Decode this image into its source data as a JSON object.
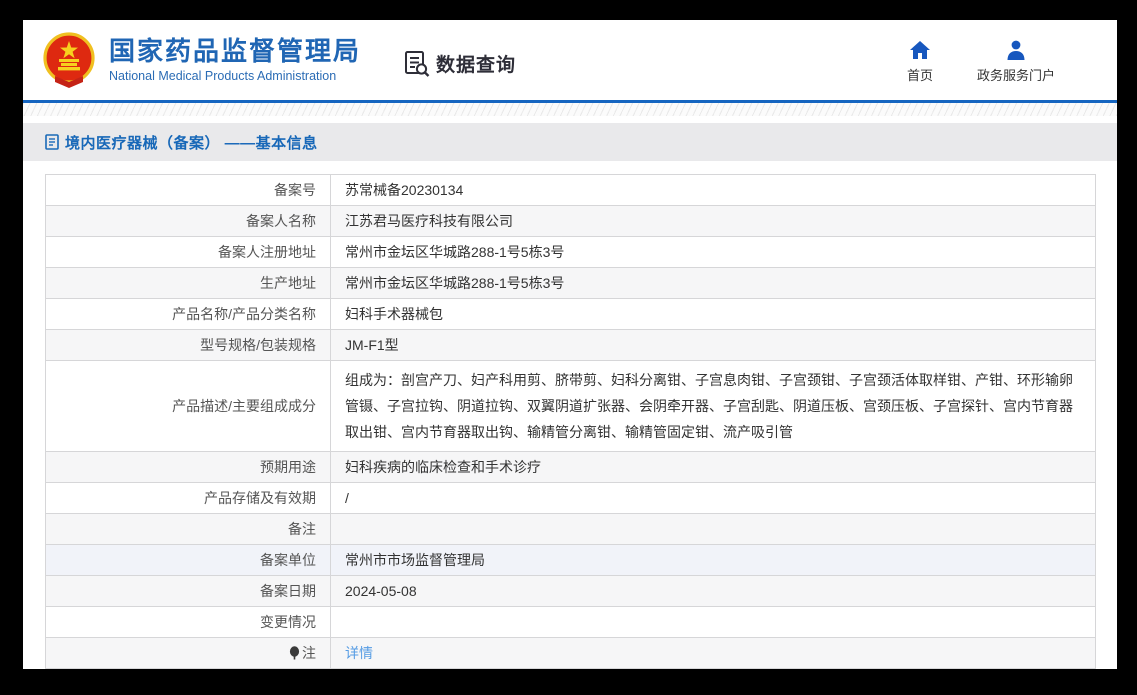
{
  "header": {
    "org_title": "国家药品监督管理局",
    "org_subtitle": "National Medical Products Administration",
    "module_title": "数据查询",
    "nav": [
      {
        "label": "首页"
      },
      {
        "label": "政务服务门户"
      }
    ]
  },
  "breadcrumb": {
    "text": "境内医疗器械（备案） ——基本信息"
  },
  "table": {
    "rows": [
      {
        "label": "备案号",
        "value": "苏常械备20230134"
      },
      {
        "label": "备案人名称",
        "value": "江苏君马医疗科技有限公司"
      },
      {
        "label": "备案人注册地址",
        "value": "常州市金坛区华城路288-1号5栋3号"
      },
      {
        "label": "生产地址",
        "value": "常州市金坛区华城路288-1号5栋3号"
      },
      {
        "label": "产品名称/产品分类名称",
        "value": "妇科手术器械包"
      },
      {
        "label": "型号规格/包装规格",
        "value": "JM-F1型"
      },
      {
        "label": "产品描述/主要组成成分",
        "value": "组成为：剖宫产刀、妇产科用剪、脐带剪、妇科分离钳、子宫息肉钳、子宫颈钳、子宫颈活体取样钳、产钳、环形输卵管镊、子宫拉钩、阴道拉钩、双翼阴道扩张器、会阴牵开器、子宫刮匙、阴道压板、宫颈压板、子宫探针、宫内节育器取出钳、宫内节育器取出钩、输精管分离钳、输精管固定钳、流产吸引管"
      },
      {
        "label": "预期用途",
        "value": "妇科疾病的临床检查和手术诊疗"
      },
      {
        "label": "产品存储及有效期",
        "value": "/"
      },
      {
        "label": "备注",
        "value": ""
      },
      {
        "label": "备案单位",
        "value": "常州市市场监督管理局"
      },
      {
        "label": "备案日期",
        "value": "2024-05-08"
      },
      {
        "label": "变更情况",
        "value": ""
      },
      {
        "label": "注",
        "value": "详情"
      }
    ]
  },
  "colors": {
    "brand_blue": "#2066b4",
    "divider_blue": "#1565c0",
    "breadcrumb_blue": "#1868b8",
    "link_blue": "#569ce4",
    "stripe_gray": "#f6f6f7",
    "hover_row": "#f1f3f9",
    "emblem_red": "#de2910",
    "emblem_gold": "#f0c020"
  }
}
